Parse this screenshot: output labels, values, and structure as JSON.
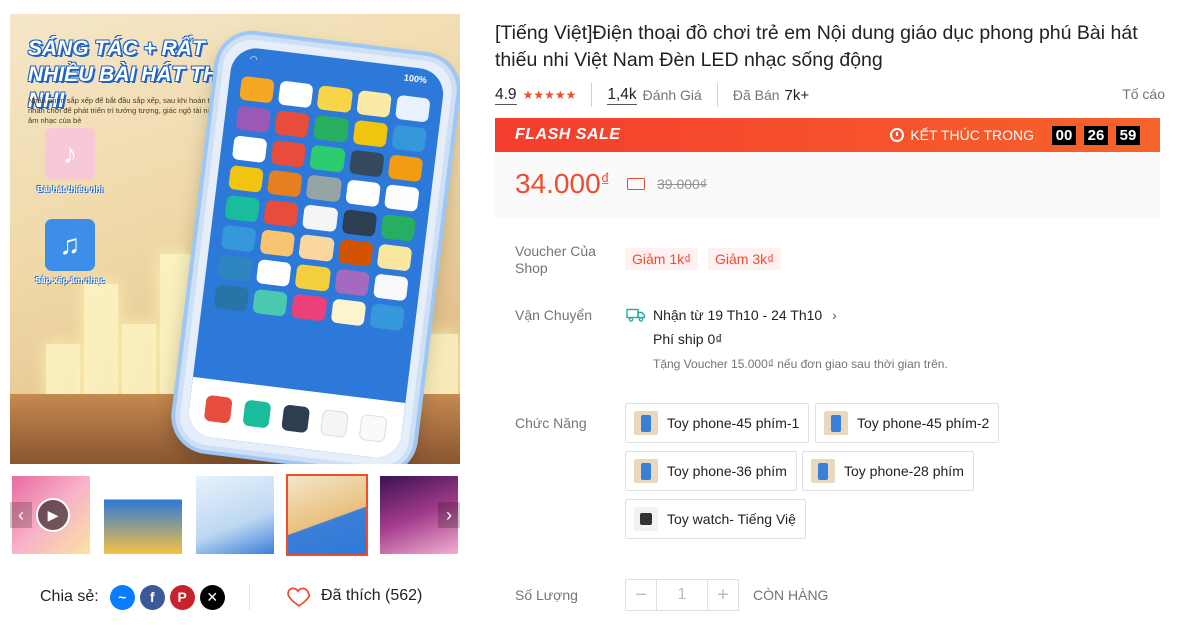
{
  "gallery": {
    "headline": "SÁNG TÁC + RẤT NHIỀU BÀI HÁT THIẾU NHI",
    "subcopy": "Nhấn phím sắp xếp để bắt đầu sắp xếp, sau khi hoàn thành nhấn chơi để phát triển trí tưởng tượng, giác ngộ tài năng âm nhạc của bé",
    "feature_1": "Bài hát thiếu nhi",
    "feature_2": "Sắp xếp âm nhạc",
    "phone_battery": "100%",
    "thumbnails": [
      "video",
      "promo",
      "phone-white",
      "phone-orange",
      "plush"
    ]
  },
  "share": {
    "label": "Chia sẻ:",
    "networks": [
      "messenger-icon",
      "facebook-icon",
      "pinterest-icon",
      "x-icon"
    ]
  },
  "like": {
    "label": "Đã thích (562)"
  },
  "product": {
    "title": "[Tiếng Việt]Điện thoại đồ chơi trẻ em Nội dung giáo dục phong phú Bài hát thiếu nhi Việt Nam Đèn LED nhạc sống động",
    "rating": "4.9",
    "stars": 5,
    "reviews_count": "1,4k",
    "reviews_label": "Đánh Giá",
    "sold_label": "Đã Bán",
    "sold_count": "7k+",
    "report": "Tố cáo"
  },
  "flash_sale": {
    "logo": "FLASH SALE",
    "ends_label": "KẾT THÚC TRONG",
    "hours": "00",
    "minutes": "26",
    "seconds": "59"
  },
  "price": {
    "current": "34.000",
    "currency": "₫",
    "original": "39.000₫"
  },
  "voucher": {
    "label": "Voucher Của Shop",
    "items": [
      "Giảm 1k₫",
      "Giảm 3k₫"
    ]
  },
  "shipping": {
    "label": "Vận Chuyển",
    "delivery": "Nhận từ 19 Th10 - 24 Th10",
    "fee": "Phí ship 0₫",
    "note": "Tặng Voucher 15.000₫ nếu đơn giao sau thời gian trên."
  },
  "variants": {
    "label": "Chức Năng",
    "options": [
      "Toy phone-45 phím-1",
      "Toy phone-45 phím-2",
      "Toy phone-36 phím",
      "Toy phone-28 phím",
      "Toy watch- Tiếng Việ"
    ]
  },
  "quantity": {
    "label": "Số Lượng",
    "value": "1",
    "stock": "CÒN HÀNG"
  },
  "colors": {
    "accent": "#ee4d2d",
    "muted": "#757575"
  }
}
